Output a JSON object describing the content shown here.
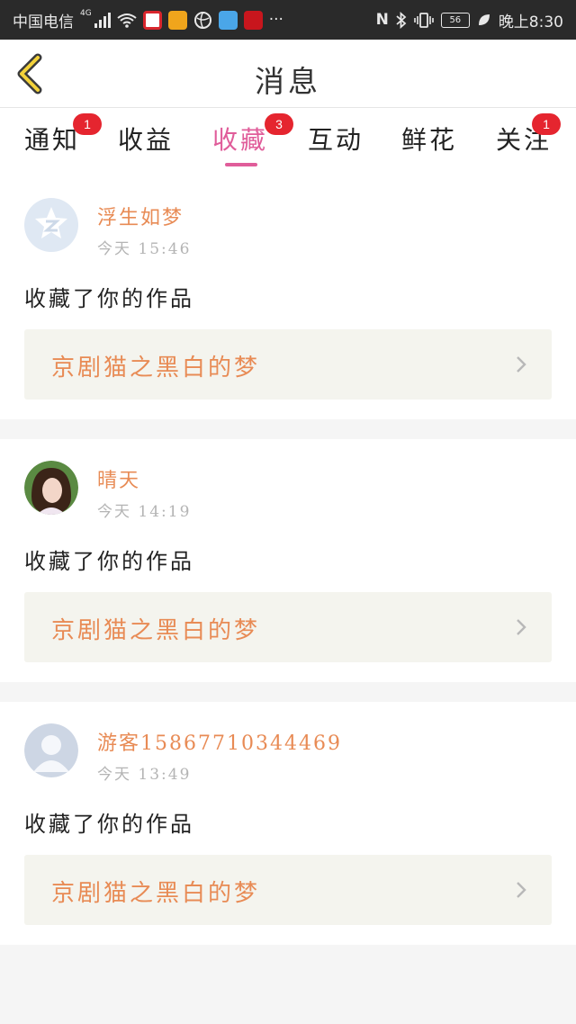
{
  "status_bar": {
    "carrier": "中国电信",
    "network": "4G",
    "more": "···",
    "battery": "56",
    "time": "晚上8:30"
  },
  "header": {
    "title": "消息"
  },
  "tabs": [
    {
      "label": "通知",
      "badge": "1"
    },
    {
      "label": "收益",
      "badge": ""
    },
    {
      "label": "收藏",
      "badge": "3",
      "active": true
    },
    {
      "label": "互动",
      "badge": ""
    },
    {
      "label": "鲜花",
      "badge": ""
    },
    {
      "label": "关注",
      "badge": "1"
    }
  ],
  "messages": [
    {
      "user": "浮生如梦",
      "time": "今天  15:46",
      "action": "收藏了你的作品",
      "work": "京剧猫之黑白的梦"
    },
    {
      "user": "晴天",
      "time": "今天  14:19",
      "action": "收藏了你的作品",
      "work": "京剧猫之黑白的梦"
    },
    {
      "user": "游客15867710344469",
      "time": "今天  13:49",
      "action": "收藏了你的作品",
      "work": "京剧猫之黑白的梦"
    }
  ],
  "colors": {
    "accent": "#e05d9a",
    "name": "#e88b55",
    "badge": "#e5252f"
  }
}
